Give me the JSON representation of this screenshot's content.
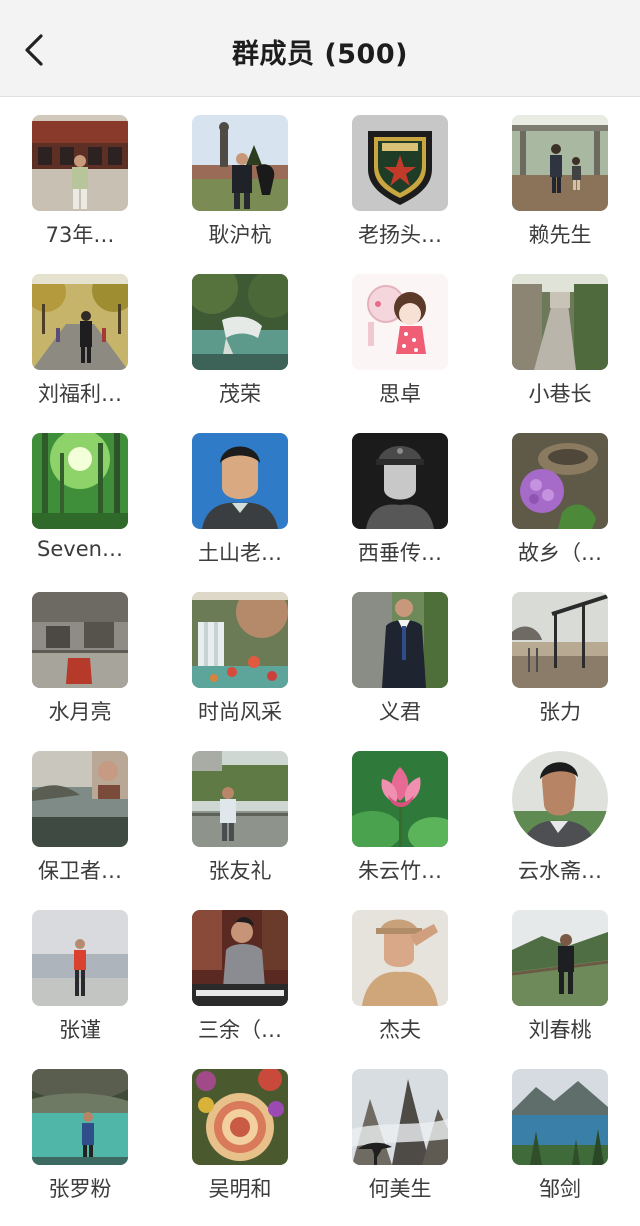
{
  "header": {
    "back_icon": "chevron-left-icon",
    "title": "群成员 (500)"
  },
  "members": [
    {
      "name": "73年…",
      "icon": "photo-man-building"
    },
    {
      "name": "耿沪杭",
      "icon": "photo-man-statue"
    },
    {
      "name": "老扬头…",
      "icon": "army-badge"
    },
    {
      "name": "赖先生",
      "icon": "photo-boardwalk"
    },
    {
      "name": "刘福利…",
      "icon": "photo-avenue"
    },
    {
      "name": "茂荣",
      "icon": "photo-waterfall-green"
    },
    {
      "name": "思卓",
      "icon": "cartoon-girl"
    },
    {
      "name": "小巷长",
      "icon": "photo-alley"
    },
    {
      "name": "Seven…",
      "icon": "photo-forest-sun"
    },
    {
      "name": "土山老…",
      "icon": "portrait-blue"
    },
    {
      "name": "西垂传…",
      "icon": "portrait-soldier-bw"
    },
    {
      "name": "故乡（…",
      "icon": "photo-hydrangea"
    },
    {
      "name": "水月亮",
      "icon": "photo-rock-carving"
    },
    {
      "name": "时尚风采",
      "icon": "photo-waterfall-flowers"
    },
    {
      "name": "义君",
      "icon": "photo-man-suit"
    },
    {
      "name": "张力",
      "icon": "photo-park-structure"
    },
    {
      "name": "保卫者…",
      "icon": "photo-lake-portrait"
    },
    {
      "name": "张友礼",
      "icon": "photo-man-railing"
    },
    {
      "name": "朱云竹…",
      "icon": "photo-lotus"
    },
    {
      "name": "云水斋…",
      "icon": "portrait-circle"
    },
    {
      "name": "张谨",
      "icon": "photo-man-beach"
    },
    {
      "name": "三余（…",
      "icon": "photo-man-piano"
    },
    {
      "name": "杰夫",
      "icon": "portrait-salute"
    },
    {
      "name": "刘春桃",
      "icon": "photo-man-mountain"
    },
    {
      "name": "张罗粉",
      "icon": "photo-cave-lake"
    },
    {
      "name": "吴明和",
      "icon": "photo-chrysanthemum"
    },
    {
      "name": "何美生",
      "icon": "painting-mountains"
    },
    {
      "name": "邹剑",
      "icon": "photo-lake-mountains"
    }
  ]
}
